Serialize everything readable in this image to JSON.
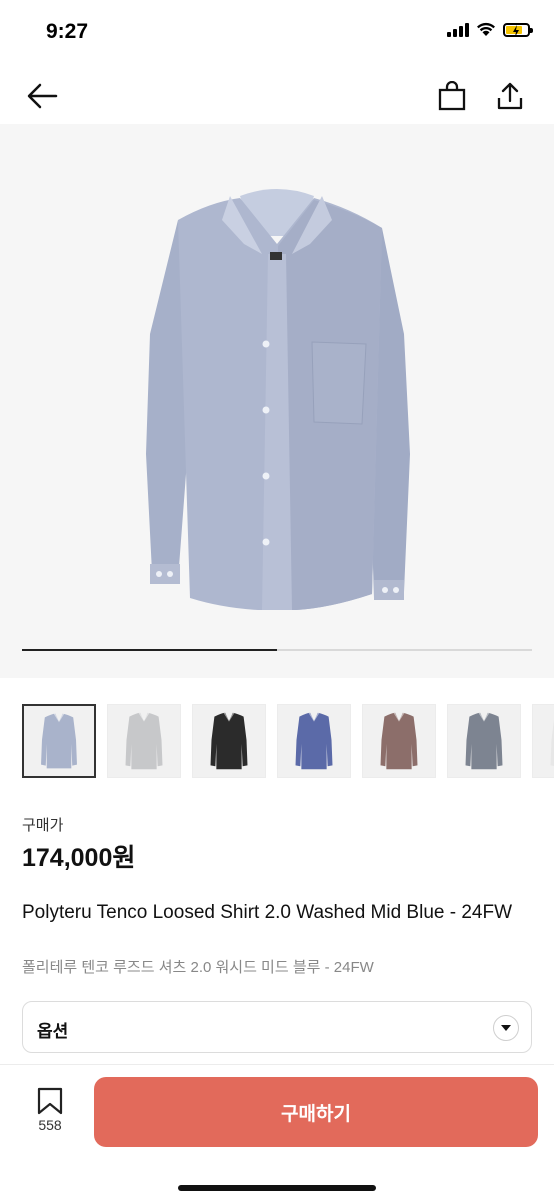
{
  "status_bar": {
    "time": "9:27"
  },
  "hero": {
    "image_progress": 0.5
  },
  "thumbnails": [
    {
      "color": "#a9b3cb",
      "selected": true
    },
    {
      "color": "#c7c8ca",
      "selected": false
    },
    {
      "color": "#2b2b2b",
      "selected": false
    },
    {
      "color": "#5b6aa8",
      "selected": false
    },
    {
      "color": "#8c6e6a",
      "selected": false
    },
    {
      "color": "#7d8491",
      "selected": false
    },
    {
      "color": "#e7e7e7",
      "selected": false
    }
  ],
  "price": {
    "label": "구매가",
    "value": "174,000원"
  },
  "product": {
    "title_en": "Polyteru Tenco Loosed Shirt 2.0 Washed Mid Blue - 24FW",
    "title_ko": "폴리테루 텐코 루즈드 셔츠 2.0 워시드 미드 블루 - 24FW"
  },
  "option": {
    "label": "옵션"
  },
  "bottom": {
    "wish_count": "558",
    "buy_label": "구매하기"
  },
  "colors": {
    "accent": "#e26a5b"
  }
}
